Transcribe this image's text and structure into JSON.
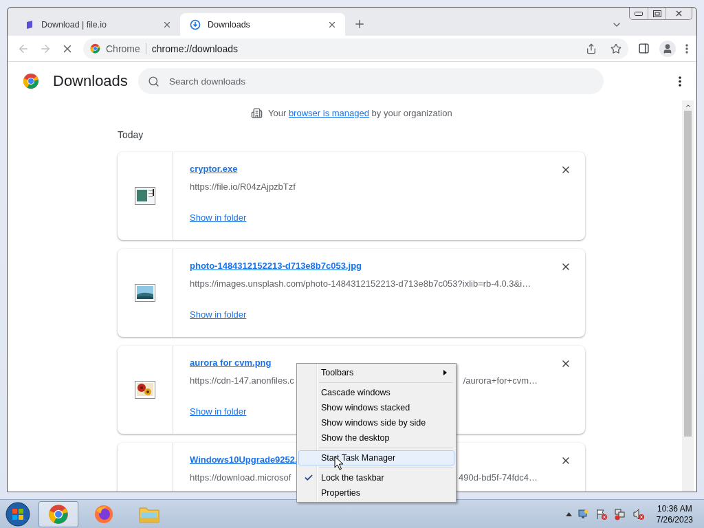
{
  "tabs": [
    {
      "title": "Download | file.io",
      "selected": false
    },
    {
      "title": "Downloads",
      "selected": true
    }
  ],
  "address_bar": {
    "site_label": "Chrome",
    "url": "chrome://downloads"
  },
  "page": {
    "title": "Downloads",
    "search": {
      "placeholder": "Search downloads"
    },
    "managed_notice": {
      "before": "Your ",
      "link": "browser is managed",
      "after": " by your organization"
    },
    "section": "Today",
    "downloads": [
      {
        "name": "cryptor.exe",
        "url_parts": [
          "https://file.io/R04zAjpzbTzf"
        ],
        "action": "Show in folder",
        "kind": "exe"
      },
      {
        "name": "photo-1484312152213-d713e8b7c053.jpg",
        "url_parts": [
          "https://images.unsplash.com/photo-1484312152213-d713e8b7c053?ixlib=rb-4.0.3&i…"
        ],
        "action": "Show in folder",
        "kind": "photo"
      },
      {
        "name": "aurora for cvm.png",
        "url_parts": [
          "https://cdn-147.anonfiles.c",
          "/aurora+for+cvm…"
        ],
        "action": "Show in folder",
        "kind": "flowers"
      },
      {
        "name": "Windows10Upgrade9252.",
        "url_parts": [
          "https://download.microsof",
          "490d-bd5f-74fdc4…"
        ],
        "kind": "none"
      }
    ]
  },
  "context_menu": {
    "groups": [
      [
        {
          "label": "Toolbars",
          "submenu": true,
          "checked": false,
          "selected": false
        }
      ],
      [
        {
          "label": "Cascade windows",
          "submenu": false,
          "checked": false,
          "selected": false
        },
        {
          "label": "Show windows stacked",
          "submenu": false,
          "checked": false,
          "selected": false
        },
        {
          "label": "Show windows side by side",
          "submenu": false,
          "checked": false,
          "selected": false
        },
        {
          "label": "Show the desktop",
          "submenu": false,
          "checked": false,
          "selected": false
        }
      ],
      [
        {
          "label": "Start Task Manager",
          "submenu": false,
          "checked": false,
          "selected": true
        }
      ],
      [
        {
          "label": "Lock the taskbar",
          "submenu": false,
          "checked": true,
          "selected": false
        },
        {
          "label": "Properties",
          "submenu": false,
          "checked": false,
          "selected": false
        }
      ]
    ]
  },
  "taskbar": {
    "apps": [
      {
        "kind": "chrome",
        "selected": true
      },
      {
        "kind": "firefox",
        "selected": false
      },
      {
        "kind": "explorer",
        "selected": false
      }
    ],
    "clock": {
      "time": "10:36 AM",
      "date": "7/26/2023"
    }
  }
}
